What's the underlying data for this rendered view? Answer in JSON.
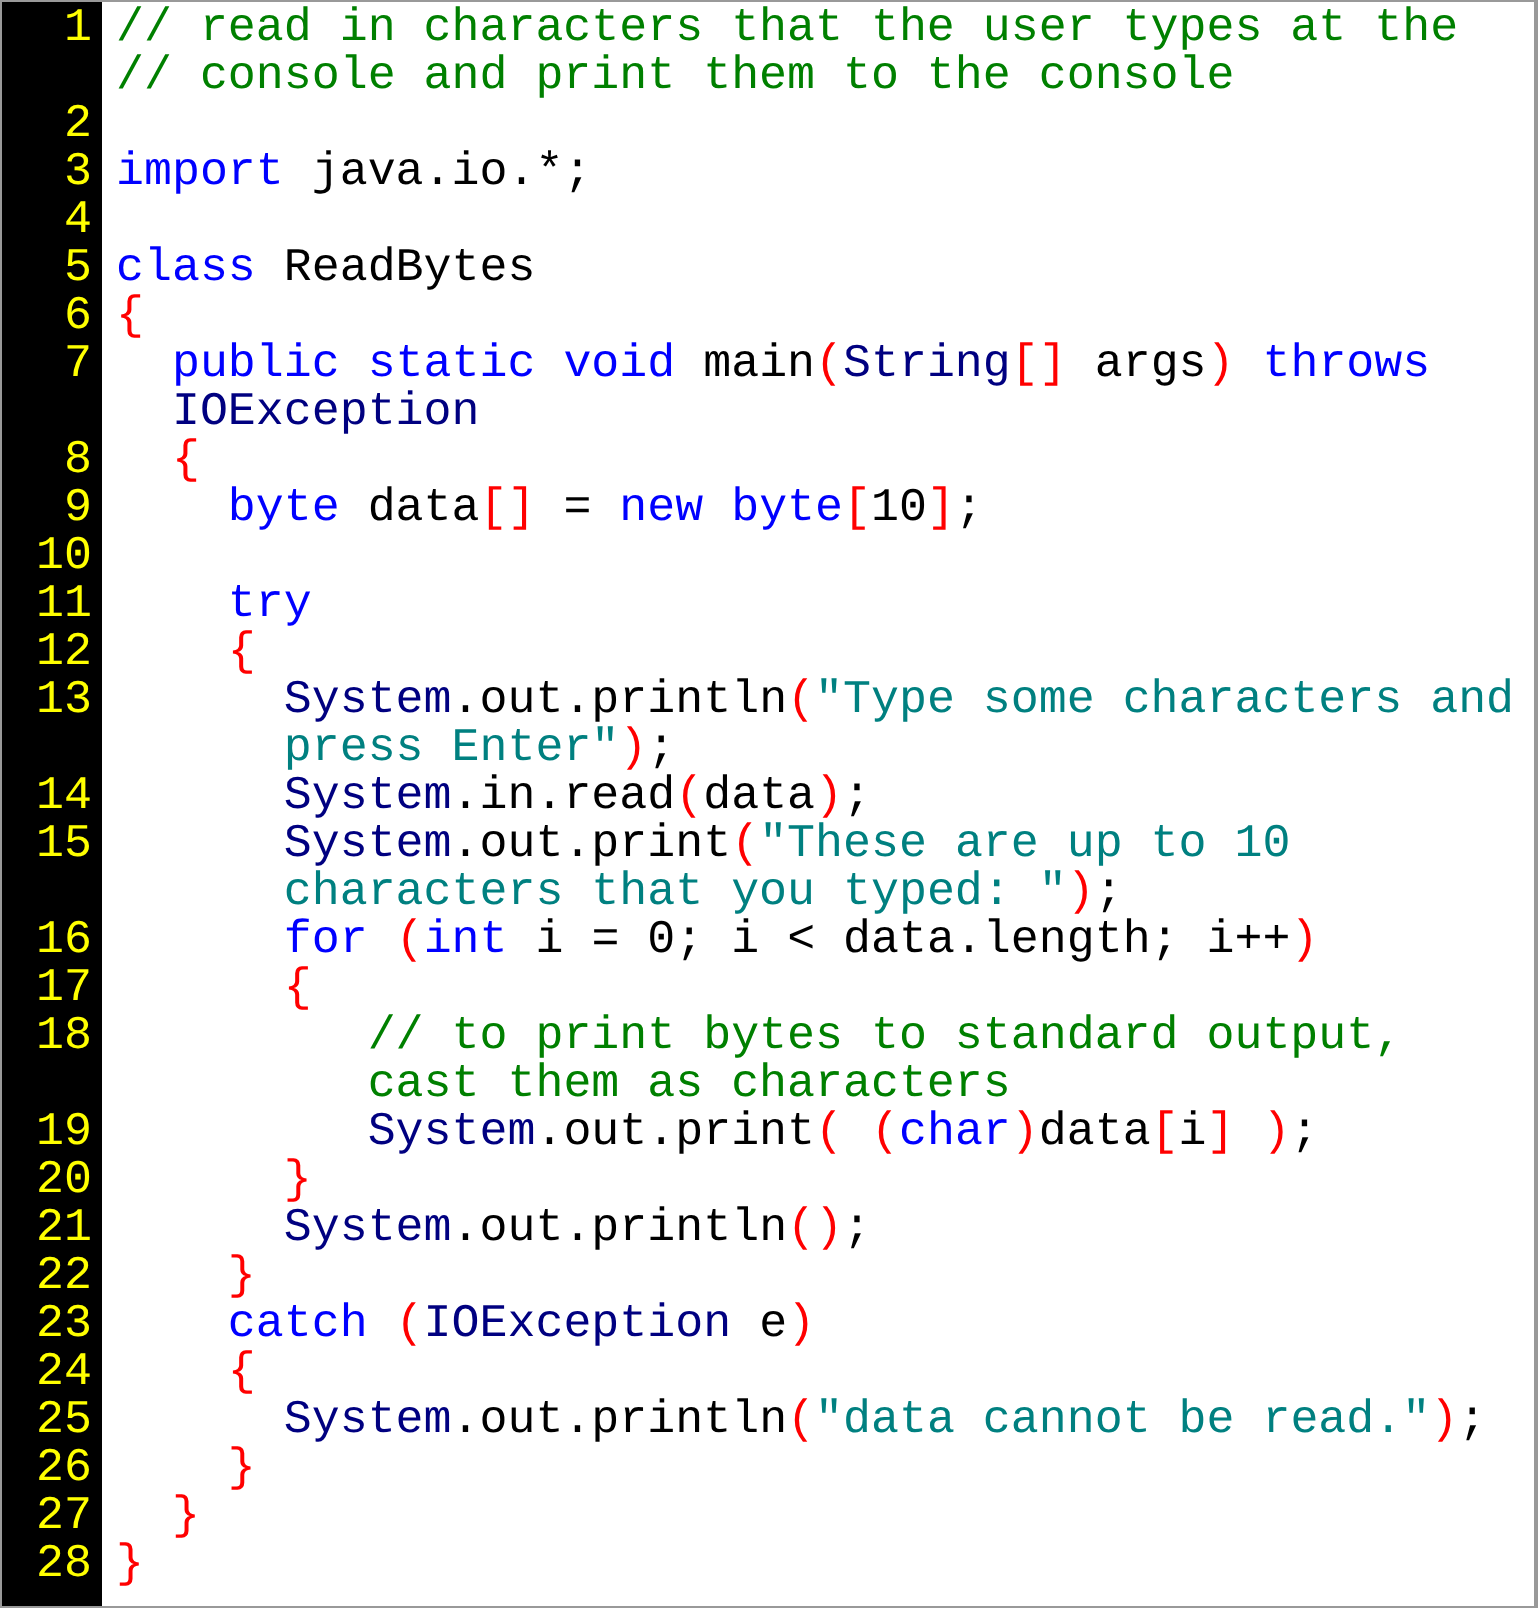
{
  "editor": {
    "lines": [
      {
        "number": "1",
        "rows": [
          {
            "segments": [
              {
                "kind": "comment",
                "text": "// read in characters that the user types at the"
              }
            ]
          },
          {
            "segments": [
              {
                "kind": "comment",
                "text": "// console and print them to the console"
              }
            ]
          }
        ]
      },
      {
        "number": "2"
      },
      {
        "number": "3",
        "rows": [
          {
            "segments": [
              {
                "kind": "keyword",
                "text": "import"
              },
              {
                "kind": "plain",
                "text": " java.io.*;"
              }
            ]
          }
        ]
      },
      {
        "number": "4"
      },
      {
        "number": "5",
        "rows": [
          {
            "segments": [
              {
                "kind": "keyword",
                "text": "class"
              },
              {
                "kind": "plain",
                "text": " ReadBytes"
              }
            ]
          }
        ]
      },
      {
        "number": "6",
        "rows": [
          {
            "segments": [
              {
                "kind": "punct",
                "text": "{"
              }
            ]
          }
        ]
      },
      {
        "number": "7",
        "rows": [
          {
            "segments": [
              {
                "kind": "keyword",
                "text": "  public static void"
              },
              {
                "kind": "plain",
                "text": " main"
              },
              {
                "kind": "punct",
                "text": "("
              },
              {
                "kind": "type",
                "text": "String"
              },
              {
                "kind": "punct",
                "text": "[]"
              },
              {
                "kind": "plain",
                "text": " args"
              },
              {
                "kind": "punct",
                "text": ")"
              },
              {
                "kind": "keyword",
                "text": " throws"
              }
            ]
          },
          {
            "segments": [
              {
                "kind": "type",
                "text": "  IOException"
              }
            ]
          }
        ]
      },
      {
        "number": "8",
        "rows": [
          {
            "segments": [
              {
                "kind": "punct",
                "text": "  {"
              }
            ]
          }
        ]
      },
      {
        "number": "9",
        "rows": [
          {
            "segments": [
              {
                "kind": "keyword",
                "text": "    byte"
              },
              {
                "kind": "plain",
                "text": " data"
              },
              {
                "kind": "punct",
                "text": "[]"
              },
              {
                "kind": "plain",
                "text": " = "
              },
              {
                "kind": "keyword",
                "text": "new byte"
              },
              {
                "kind": "punct",
                "text": "["
              },
              {
                "kind": "plain",
                "text": "10"
              },
              {
                "kind": "punct",
                "text": "]"
              },
              {
                "kind": "plain",
                "text": ";"
              }
            ]
          }
        ]
      },
      {
        "number": "10"
      },
      {
        "number": "11",
        "rows": [
          {
            "segments": [
              {
                "kind": "keyword",
                "text": "    try"
              }
            ]
          }
        ]
      },
      {
        "number": "12",
        "rows": [
          {
            "segments": [
              {
                "kind": "punct",
                "text": "    {"
              }
            ]
          }
        ]
      },
      {
        "number": "13",
        "rows": [
          {
            "segments": [
              {
                "kind": "type",
                "text": "      System"
              },
              {
                "kind": "plain",
                "text": ".out.println"
              },
              {
                "kind": "punct",
                "text": "("
              },
              {
                "kind": "string",
                "text": "\"Type some characters and"
              }
            ]
          },
          {
            "segments": [
              {
                "kind": "string",
                "text": "      press Enter\""
              },
              {
                "kind": "punct",
                "text": ")"
              },
              {
                "kind": "plain",
                "text": ";"
              }
            ]
          }
        ]
      },
      {
        "number": "14",
        "rows": [
          {
            "segments": [
              {
                "kind": "type",
                "text": "      System"
              },
              {
                "kind": "plain",
                "text": ".in.read"
              },
              {
                "kind": "punct",
                "text": "("
              },
              {
                "kind": "plain",
                "text": "data"
              },
              {
                "kind": "punct",
                "text": ")"
              },
              {
                "kind": "plain",
                "text": ";"
              }
            ]
          }
        ]
      },
      {
        "number": "15",
        "rows": [
          {
            "segments": [
              {
                "kind": "type",
                "text": "      System"
              },
              {
                "kind": "plain",
                "text": ".out.print"
              },
              {
                "kind": "punct",
                "text": "("
              },
              {
                "kind": "string",
                "text": "\"These are up to 10"
              }
            ]
          },
          {
            "segments": [
              {
                "kind": "string",
                "text": "      characters that you typed: \""
              },
              {
                "kind": "punct",
                "text": ")"
              },
              {
                "kind": "plain",
                "text": ";"
              }
            ]
          }
        ]
      },
      {
        "number": "16",
        "rows": [
          {
            "segments": [
              {
                "kind": "keyword",
                "text": "      for"
              },
              {
                "kind": "punct",
                "text": " ("
              },
              {
                "kind": "keyword",
                "text": "int"
              },
              {
                "kind": "plain",
                "text": " i = 0; i < data.length; i++"
              },
              {
                "kind": "punct",
                "text": ")"
              }
            ]
          }
        ]
      },
      {
        "number": "17",
        "rows": [
          {
            "segments": [
              {
                "kind": "punct",
                "text": "      {"
              }
            ]
          }
        ]
      },
      {
        "number": "18",
        "rows": [
          {
            "segments": [
              {
                "kind": "comment",
                "text": "         // to print bytes to standard output,"
              }
            ]
          },
          {
            "segments": [
              {
                "kind": "comment",
                "text": "         cast them as characters"
              }
            ]
          }
        ]
      },
      {
        "number": "19",
        "rows": [
          {
            "segments": [
              {
                "kind": "type",
                "text": "         System"
              },
              {
                "kind": "plain",
                "text": ".out.print"
              },
              {
                "kind": "punct",
                "text": "( ("
              },
              {
                "kind": "keyword",
                "text": "char"
              },
              {
                "kind": "punct",
                "text": ")"
              },
              {
                "kind": "plain",
                "text": "data"
              },
              {
                "kind": "punct",
                "text": "["
              },
              {
                "kind": "plain",
                "text": "i"
              },
              {
                "kind": "punct",
                "text": "] )"
              },
              {
                "kind": "plain",
                "text": ";"
              }
            ]
          }
        ]
      },
      {
        "number": "20",
        "rows": [
          {
            "segments": [
              {
                "kind": "punct",
                "text": "      }"
              }
            ]
          }
        ]
      },
      {
        "number": "21",
        "rows": [
          {
            "segments": [
              {
                "kind": "type",
                "text": "      System"
              },
              {
                "kind": "plain",
                "text": ".out.println"
              },
              {
                "kind": "punct",
                "text": "()"
              },
              {
                "kind": "plain",
                "text": ";"
              }
            ]
          }
        ]
      },
      {
        "number": "22",
        "rows": [
          {
            "segments": [
              {
                "kind": "punct",
                "text": "    }"
              }
            ]
          }
        ]
      },
      {
        "number": "23",
        "rows": [
          {
            "segments": [
              {
                "kind": "keyword",
                "text": "    catch"
              },
              {
                "kind": "punct",
                "text": " ("
              },
              {
                "kind": "type",
                "text": "IOException"
              },
              {
                "kind": "plain",
                "text": " e"
              },
              {
                "kind": "punct",
                "text": ")"
              }
            ]
          }
        ]
      },
      {
        "number": "24",
        "rows": [
          {
            "segments": [
              {
                "kind": "punct",
                "text": "    {"
              }
            ]
          }
        ]
      },
      {
        "number": "25",
        "rows": [
          {
            "segments": [
              {
                "kind": "type",
                "text": "      System"
              },
              {
                "kind": "plain",
                "text": ".out.println"
              },
              {
                "kind": "punct",
                "text": "("
              },
              {
                "kind": "string",
                "text": "\"data cannot be read.\""
              },
              {
                "kind": "punct",
                "text": ")"
              },
              {
                "kind": "plain",
                "text": ";"
              }
            ]
          }
        ]
      },
      {
        "number": "26",
        "rows": [
          {
            "segments": [
              {
                "kind": "punct",
                "text": "    }"
              }
            ]
          }
        ]
      },
      {
        "number": "27",
        "rows": [
          {
            "segments": [
              {
                "kind": "punct",
                "text": "  }"
              }
            ]
          }
        ]
      },
      {
        "number": "28",
        "rows": [
          {
            "segments": [
              {
                "kind": "punct",
                "text": "}"
              }
            ]
          }
        ]
      }
    ]
  }
}
